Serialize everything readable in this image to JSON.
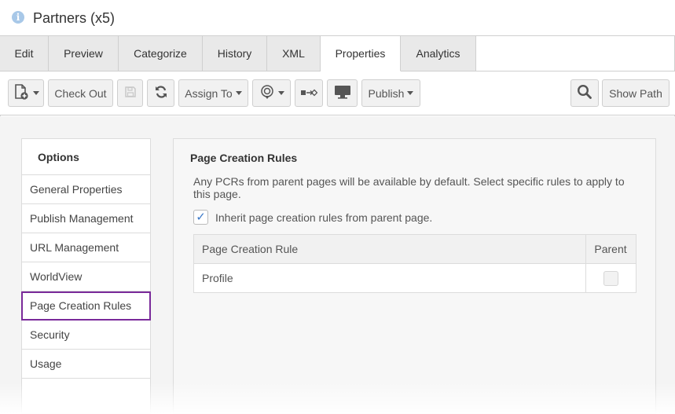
{
  "window": {
    "title": "Partners (x5)",
    "icon": "info-icon"
  },
  "tabs": [
    {
      "label": "Edit",
      "active": false
    },
    {
      "label": "Preview",
      "active": false
    },
    {
      "label": "Categorize",
      "active": false
    },
    {
      "label": "History",
      "active": false
    },
    {
      "label": "XML",
      "active": false
    },
    {
      "label": "Properties",
      "active": true
    },
    {
      "label": "Analytics",
      "active": false
    }
  ],
  "toolbar": {
    "new_icon": "new-page-icon",
    "check_out": "Check Out",
    "save_icon": "save-icon",
    "refresh_icon": "refresh-icon",
    "assign_to": "Assign To",
    "workflow_icon": "workflow-icon",
    "link_icon": "link-icon",
    "preview_icon": "monitor-icon",
    "publish": "Publish",
    "search_icon": "search-icon",
    "show_path": "Show Path"
  },
  "options": {
    "header": "Options",
    "items": [
      {
        "label": "General Properties",
        "selected": false
      },
      {
        "label": "Publish Management",
        "selected": false
      },
      {
        "label": "URL Management",
        "selected": false
      },
      {
        "label": "WorldView",
        "selected": false
      },
      {
        "label": "Page Creation Rules",
        "selected": true
      },
      {
        "label": "Security",
        "selected": false
      },
      {
        "label": "Usage",
        "selected": false
      }
    ]
  },
  "panel": {
    "title": "Page Creation Rules",
    "description": "Any PCRs from parent pages will be available by default. Select specific rules to apply to this page.",
    "inherit_label": "Inherit page creation rules from parent page.",
    "inherit_checked": true,
    "check_mark": "✓",
    "table": {
      "columns": [
        "Page Creation Rule",
        "Parent"
      ],
      "rows": [
        {
          "rule": "Profile",
          "parent": false
        }
      ]
    }
  },
  "colors": {
    "selected_border": "#7a2a9a",
    "checkbox_accent": "#3a78c8"
  }
}
